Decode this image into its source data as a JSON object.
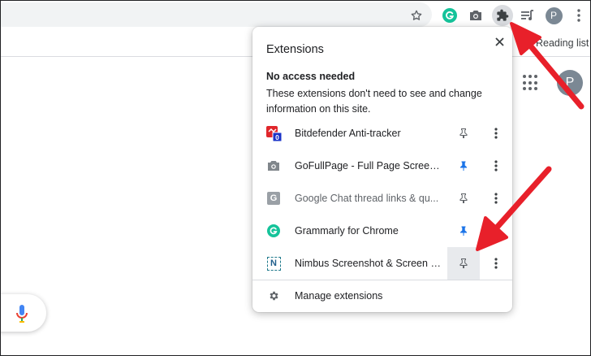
{
  "toolbar": {
    "profile_initial": "P",
    "icons": [
      "star-icon",
      "grammarly-icon",
      "camera-icon",
      "puzzle-icon",
      "reading-list-icon",
      "avatar",
      "more-icon"
    ]
  },
  "bookmarks": {
    "reading_list_label": "Reading list"
  },
  "page": {
    "avatar_initial": "P"
  },
  "popup": {
    "title": "Extensions",
    "section_heading": "No access needed",
    "section_description": "These extensions don't need to see and change information on this site.",
    "extensions": [
      {
        "name": "Bitdefender Anti-tracker",
        "icon": "bitdefender-icon",
        "badge": "0",
        "pinned": false
      },
      {
        "name": "GoFullPage - Full Page Screen...",
        "icon": "camera-icon",
        "pinned": true
      },
      {
        "name": "Google Chat thread links & qu...",
        "icon": "google-chat-icon",
        "icon_letter": "G",
        "pinned": false
      },
      {
        "name": "Grammarly for Chrome",
        "icon": "grammarly-icon",
        "pinned": true
      },
      {
        "name": "Nimbus Screenshot & Screen V...",
        "icon": "nimbus-icon",
        "icon_letter": "N",
        "pinned": false
      }
    ],
    "manage_label": "Manage extensions"
  },
  "colors": {
    "pin_active": "#1a73e8",
    "pin_inactive": "#5f6368",
    "annotation_arrow": "#e8202a",
    "grammarly": "#15c39a",
    "bitdefender": "#e0262b"
  }
}
